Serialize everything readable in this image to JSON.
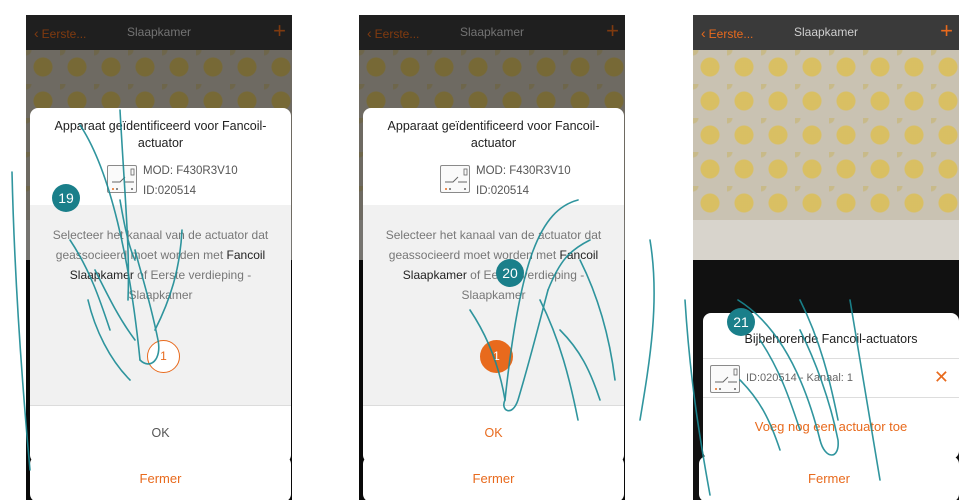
{
  "topbar": {
    "back_label": "Eerste...",
    "title": "Slaapkamer",
    "plus_symbol": "+"
  },
  "device": {
    "title": "Apparaat geïdentificeerd voor Fancoil-actuator",
    "mod": "MOD: F430R3V10",
    "id": "ID:020514"
  },
  "instruction": {
    "part1": "Selecteer het kanaal van de actuator dat geassocieerd moet worden met",
    "hl1": "Fancoil Slaapkamer",
    "part2": "of Eerste verdieping - Slaapkamer"
  },
  "channel": {
    "label": "1"
  },
  "buttons": {
    "ok": "OK",
    "fermer": "Fermer"
  },
  "associated": {
    "title": "Bijbehorende Fancoil-actuators",
    "row_text": "ID:020514 - Kanaal: 1",
    "remove_symbol": "✕",
    "add_label": "Voeg nog een actuator toe"
  },
  "steps": {
    "s1": "19",
    "s2": "20",
    "s3": "21"
  },
  "colors": {
    "accent": "#e86a1d",
    "step_badge": "#1a7f8a",
    "topbar": "#3a3a3a"
  }
}
